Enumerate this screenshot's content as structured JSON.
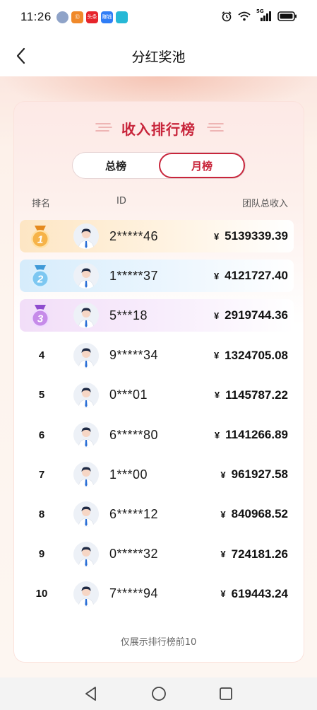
{
  "status_bar": {
    "time": "11:26",
    "app_icons": [
      {
        "name": "avatar-app-icon",
        "label": "",
        "color": "#8fa3c8"
      },
      {
        "name": "app-icon-1",
        "label": "⑫",
        "color": "#f0892a"
      },
      {
        "name": "toutiao-app-icon",
        "label": "头条",
        "color": "#e6242b"
      },
      {
        "name": "app-icon-3",
        "label": "赚钱",
        "color": "#2f7df6"
      },
      {
        "name": "app-icon-4",
        "label": "",
        "color": "#26b8d6"
      }
    ],
    "network": "5G"
  },
  "header": {
    "title": "分红奖池"
  },
  "card": {
    "title": "收入排行榜"
  },
  "tabs": {
    "total": "总榜",
    "monthly": "月榜"
  },
  "columns": {
    "rank": "排名",
    "id": "ID",
    "income": "团队总收入"
  },
  "currency": "¥",
  "rows": [
    {
      "rank": "1",
      "id": "2*****46",
      "amount": "5139339.39"
    },
    {
      "rank": "2",
      "id": "1*****37",
      "amount": "4121727.40"
    },
    {
      "rank": "3",
      "id": "5***18",
      "amount": "2919744.36"
    },
    {
      "rank": "4",
      "id": "9*****34",
      "amount": "1324705.08"
    },
    {
      "rank": "5",
      "id": "0***01",
      "amount": "1145787.22"
    },
    {
      "rank": "6",
      "id": "6*****80",
      "amount": "1141266.89"
    },
    {
      "rank": "7",
      "id": "1***00",
      "amount": "961927.58"
    },
    {
      "rank": "8",
      "id": "6*****12",
      "amount": "840968.52"
    },
    {
      "rank": "9",
      "id": "0*****32",
      "amount": "724181.26"
    },
    {
      "rank": "10",
      "id": "7*****94",
      "amount": "619443.24"
    }
  ],
  "footnote": "仅展示排行榜前10",
  "colors": {
    "accent": "#c8253b",
    "gold": "#f0a43a",
    "silver": "#4aa9df",
    "bronze": "#a35ad8"
  }
}
